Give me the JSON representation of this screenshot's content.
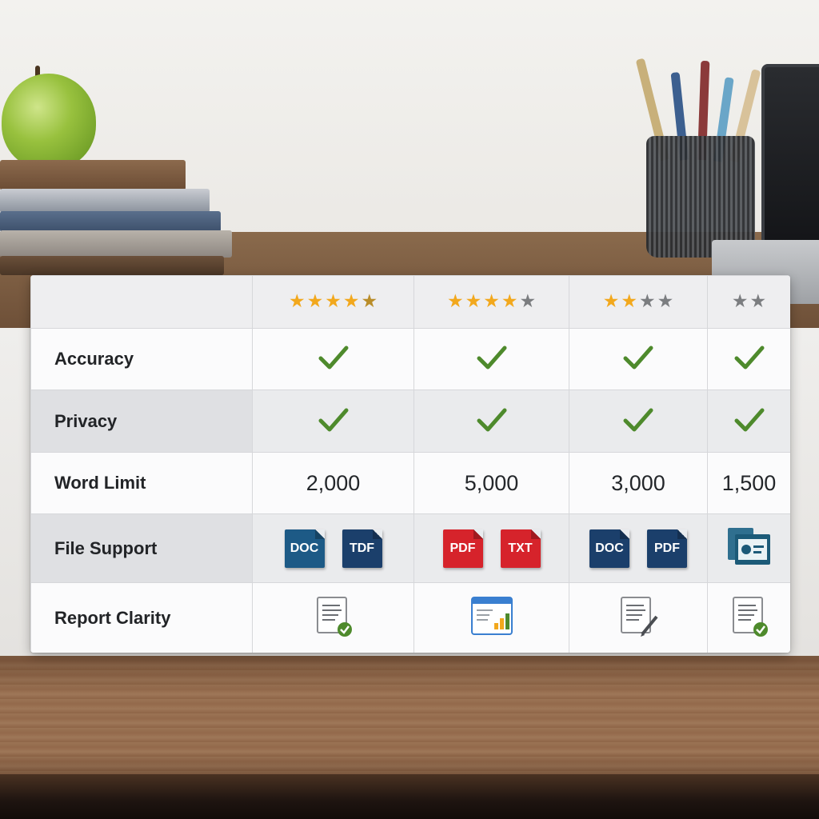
{
  "table": {
    "header": {
      "ratings": [
        {
          "stars": [
            "on",
            "on",
            "on",
            "on",
            "half"
          ]
        },
        {
          "stars": [
            "on",
            "on",
            "on",
            "on",
            "off"
          ]
        },
        {
          "stars": [
            "on",
            "on",
            "off",
            "off"
          ]
        },
        {
          "stars": [
            "off",
            "off"
          ]
        }
      ]
    },
    "rows": {
      "accuracy": {
        "label": "Accuracy",
        "values": [
          "check",
          "check",
          "check",
          "check"
        ]
      },
      "privacy": {
        "label": "Privacy",
        "values": [
          "check",
          "check",
          "check",
          "check"
        ]
      },
      "word_limit": {
        "label": "Word Limit",
        "values": [
          "2,000",
          "5,000",
          "3,000",
          "1,500"
        ]
      },
      "file_support": {
        "label": "File Support",
        "values": [
          [
            "DOC",
            "TDF"
          ],
          [
            "PDF",
            "TXT"
          ],
          [
            "DOC",
            "PDF"
          ],
          []
        ]
      },
      "report_clarity": {
        "label": "Report Clarity",
        "icons": [
          "report-check-icon",
          "report-chart-icon",
          "report-pen-icon",
          "report-check-icon"
        ]
      }
    },
    "colors": {
      "star_on": "#f2a81d",
      "star_off": "#7b7d80",
      "check": "#4e8a2c",
      "doc_blue": "#1d5a86",
      "pdf_red": "#d6232b"
    }
  }
}
